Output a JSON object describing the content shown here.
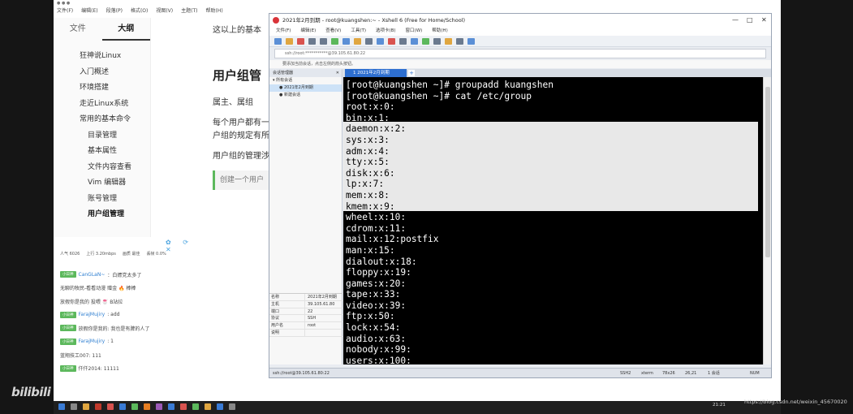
{
  "typora": {
    "tab_file": "文件",
    "tab_outline": "大纲",
    "menu": [
      "文件(F)",
      "编辑(E)",
      "段落(P)",
      "格式(O)",
      "视图(V)",
      "主题(T)",
      "帮助(H)"
    ],
    "outline": [
      {
        "label": "狂神说Linux",
        "level": 1
      },
      {
        "label": "入门概述",
        "level": 1
      },
      {
        "label": "环境搭建",
        "level": 1
      },
      {
        "label": "走近Linux系统",
        "level": 1
      },
      {
        "label": "常用的基本命令",
        "level": 1
      },
      {
        "label": "目录管理",
        "level": 2
      },
      {
        "label": "基本属性",
        "level": 2
      },
      {
        "label": "文件内容查看",
        "level": 2
      },
      {
        "label": "Vim 编辑器",
        "level": 2
      },
      {
        "label": "账号管理",
        "level": 2
      },
      {
        "label": "用户组管理",
        "level": 2,
        "active": true
      }
    ],
    "content": {
      "line1": "这以上的基本",
      "heading": "用户组管",
      "p1": "属主、属组",
      "p2a": "每个用户都有一",
      "p2b": "户组的规定有所",
      "p3": "用户组的管理涉",
      "quote": "创建一个用户"
    }
  },
  "chat": {
    "stats": [
      "人气 6026",
      "上行 3.20mbps",
      "画质 最佳",
      "丢帧 0.0%"
    ],
    "rows": [
      {
        "badge": "小日神",
        "name": "CanGLaN~",
        "text": "：白嫖党太多了"
      },
      {
        "badge": "",
        "name": "",
        "text": "无聊的牧民-看看动漫 赠金 🔥 棒棒"
      },
      {
        "badge": "",
        "name": "",
        "text": "放假你是我的 投喂 🍧 B站拉"
      },
      {
        "badge": "小日神",
        "name": "FarajMujiry",
        "text": ": add"
      },
      {
        "badge": "小日神",
        "name": "",
        "text": "放假你是我的: 我也是有脾的人了"
      },
      {
        "badge": "小日神",
        "name": "FarajMujiry",
        "text": ": 1"
      },
      {
        "badge": "",
        "name": "",
        "text": "蓝翔技工007: 111"
      },
      {
        "badge": "小日神",
        "name": "",
        "text": "仟仟2014: 11111"
      }
    ],
    "bilibili": "bilibili"
  },
  "xshell": {
    "title": "2021年2月到期 - root@kuangshen:~ - Xshell 6 (Free for Home/School)",
    "menu": [
      "文件(F)",
      "编辑(E)",
      "查看(V)",
      "工具(T)",
      "选项卡(B)",
      "窗口(W)",
      "帮助(H)"
    ],
    "address": "ssh://root:***********@39.105.61.80:22",
    "info": "要添加当前会话，点击左侧的箭头按钮。",
    "session_header": "会话管理器",
    "sessions": [
      "所有会话",
      "2021年2月到期",
      "新建会话"
    ],
    "properties": [
      {
        "k": "名称",
        "v": "2021年2月到期"
      },
      {
        "k": "主机",
        "v": "39.105.61.80"
      },
      {
        "k": "端口",
        "v": "22"
      },
      {
        "k": "协议",
        "v": "SSH"
      },
      {
        "k": "用户名",
        "v": "root"
      },
      {
        "k": "说明",
        "v": ""
      }
    ],
    "tab_label": "1 2021年2月到期",
    "status": {
      "left": "ssh://root@39.105.61.80:22",
      "ssh": "SSH2",
      "term": "xterm",
      "size": "78x26",
      "pos": "26,21",
      "sessions": "1 会话",
      "num": "NUM"
    }
  },
  "terminal": {
    "lines": [
      "[root@kuangshen ~]# groupadd kuangshen",
      "[root@kuangshen ~]# cat /etc/group",
      "root:x:0:",
      "bin:x:1:",
      "daemon:x:2:",
      "sys:x:3:",
      "adm:x:4:",
      "tty:x:5:",
      "disk:x:6:",
      "lp:x:7:",
      "mem:x:8:",
      "kmem:x:9:",
      "wheel:x:10:",
      "cdrom:x:11:",
      "mail:x:12:postfix",
      "man:x:15:",
      "dialout:x:18:",
      "floppy:x:19:",
      "games:x:20:",
      "tape:x:33:",
      "video:x:39:",
      "ftp:x:50:",
      "lock:x:54:",
      "audio:x:63:",
      "nobody:x:99:",
      "users:x:100:"
    ]
  },
  "taskbar": {
    "clock": "21:21",
    "watermark": "https://blog.csdn.net/weixin_45670020"
  },
  "colors": {
    "terminal_bg": "#000000",
    "selection_bg": "#e8e8e8",
    "xshell_tab": "#2e6fd0",
    "quote_bar": "#5cb85c"
  }
}
